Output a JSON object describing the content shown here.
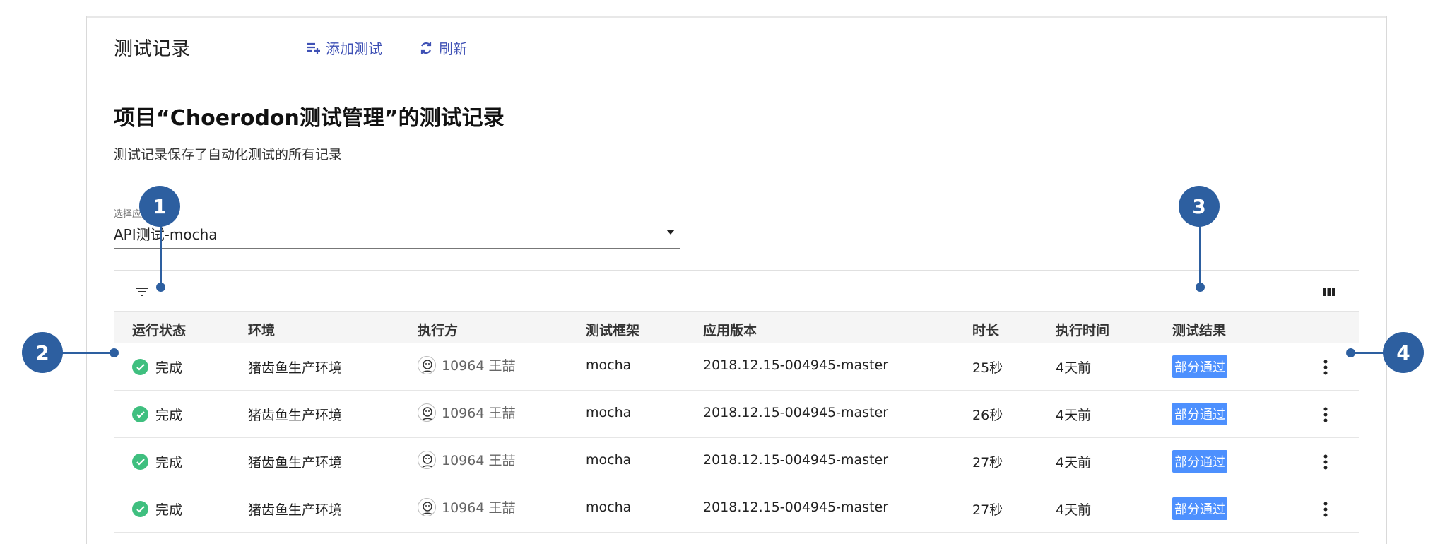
{
  "header": {
    "title": "测试记录",
    "add_label": "添加测试",
    "refresh_label": "刷新"
  },
  "main": {
    "title": "项目“Choerodon测试管理”的测试记录",
    "description": "测试记录保存了自动化测试的所有记录"
  },
  "select": {
    "label": "选择应用",
    "value": "API测试-mocha"
  },
  "table": {
    "columns": [
      "运行状态",
      "环境",
      "执行方",
      "测试框架",
      "应用版本",
      "时长",
      "执行时间",
      "测试结果"
    ],
    "rows": [
      {
        "status": "完成",
        "env": "猪齿鱼生产环境",
        "executor": "10964 王喆",
        "framework": "mocha",
        "version": "2018.12.15-004945-master",
        "duration": "25秒",
        "time": "4天前",
        "result": "部分通过"
      },
      {
        "status": "完成",
        "env": "猪齿鱼生产环境",
        "executor": "10964 王喆",
        "framework": "mocha",
        "version": "2018.12.15-004945-master",
        "duration": "26秒",
        "time": "4天前",
        "result": "部分通过"
      },
      {
        "status": "完成",
        "env": "猪齿鱼生产环境",
        "executor": "10964 王喆",
        "framework": "mocha",
        "version": "2018.12.15-004945-master",
        "duration": "27秒",
        "time": "4天前",
        "result": "部分通过"
      },
      {
        "status": "完成",
        "env": "猪齿鱼生产环境",
        "executor": "10964 王喆",
        "framework": "mocha",
        "version": "2018.12.15-004945-master",
        "duration": "27秒",
        "time": "4天前",
        "result": "部分通过"
      }
    ]
  },
  "callouts": [
    "1",
    "2",
    "3",
    "4"
  ],
  "colors": {
    "accent": "#3f51b5",
    "success": "#3fbf7f",
    "badge": "#4d90fe",
    "callout": "#2d5fa0"
  }
}
